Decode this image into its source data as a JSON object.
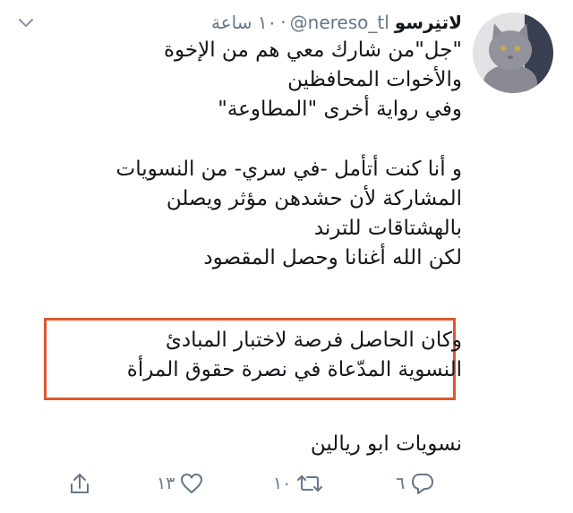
{
  "tweet": {
    "display_name": "لاتنِرسو",
    "handle": "@nereso_tl",
    "separator": "·",
    "timestamp": "١٠ ساعة",
    "body_lines": [
      "\"جل\"من شارك معي هم من الإخوة",
      "والأخوات المحافظين",
      "وفي رواية أخرى \"المطاوعة\""
    ],
    "body_lines_2": [
      "و أنا كنت أتأمل -في سري- من النسويات",
      "المشاركة لأن حشدهن مؤثر ويصلن",
      "بالهشتاقات للترند",
      "لكن الله أغنانا وحصل المقصود"
    ],
    "highlighted_lines": [
      "وكان الحاصل فرصة لاختبار المبادئ",
      "النسوية المدّعاة في نصرة حقوق المرأة"
    ],
    "trailer": "نسويات ابو ريالين",
    "actions": {
      "reply_count": "٦",
      "retweet_count": "١٠",
      "like_count": "١٣",
      "share_count": ""
    }
  },
  "colors": {
    "text": "#14171a",
    "muted": "#657786",
    "highlight_border": "#e0562f"
  },
  "icons": [
    "chevron-down-icon",
    "avatar",
    "reply-icon",
    "retweet-icon",
    "like-icon",
    "share-icon"
  ]
}
